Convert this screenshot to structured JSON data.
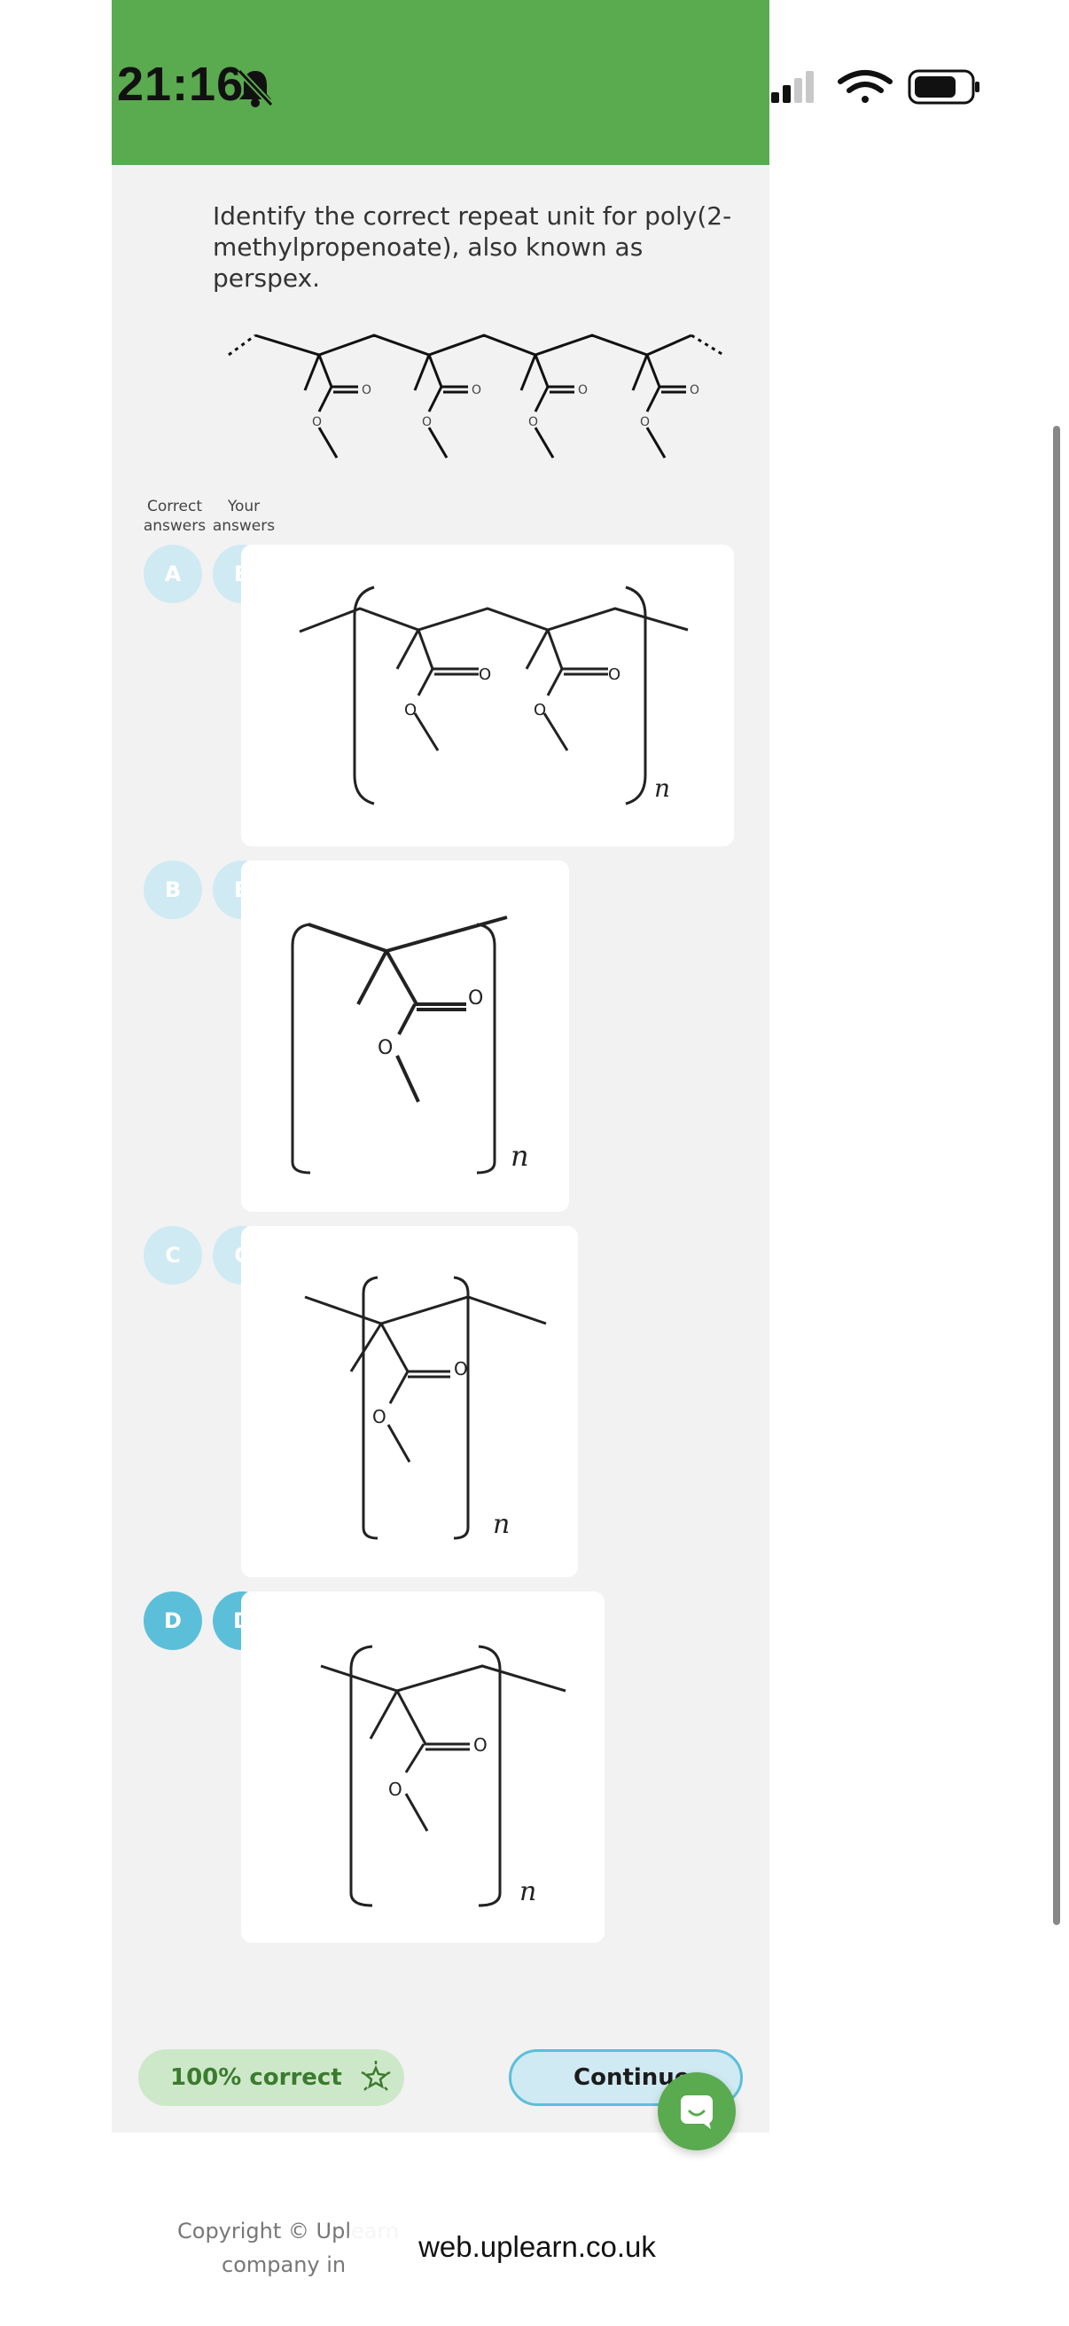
{
  "status_bar": {
    "time": "21:16"
  },
  "question": {
    "text": "Identify the correct repeat unit for poly(2-methylpropenoate), also known as perspex."
  },
  "columns": {
    "correct": "Correct answers",
    "yours": "Your answers"
  },
  "molecule_labels": {
    "oxygen": "O",
    "n": "n"
  },
  "options": [
    {
      "letter": "A",
      "correct_selected": false,
      "your_selected": false
    },
    {
      "letter": "B",
      "correct_selected": false,
      "your_selected": false
    },
    {
      "letter": "C",
      "correct_selected": false,
      "your_selected": false
    },
    {
      "letter": "D",
      "correct_selected": true,
      "your_selected": true
    }
  ],
  "result": {
    "score_label": "100% correct"
  },
  "continue_label": "Continue",
  "footer": {
    "line1": "Copyright © Uplearn",
    "line2": "company in"
  },
  "browser": {
    "url": "web.uplearn.co.uk"
  },
  "colors": {
    "brand_green": "#5aaa4f",
    "option_light": "#cfeaf2",
    "option_selected": "#5cbfd9"
  }
}
